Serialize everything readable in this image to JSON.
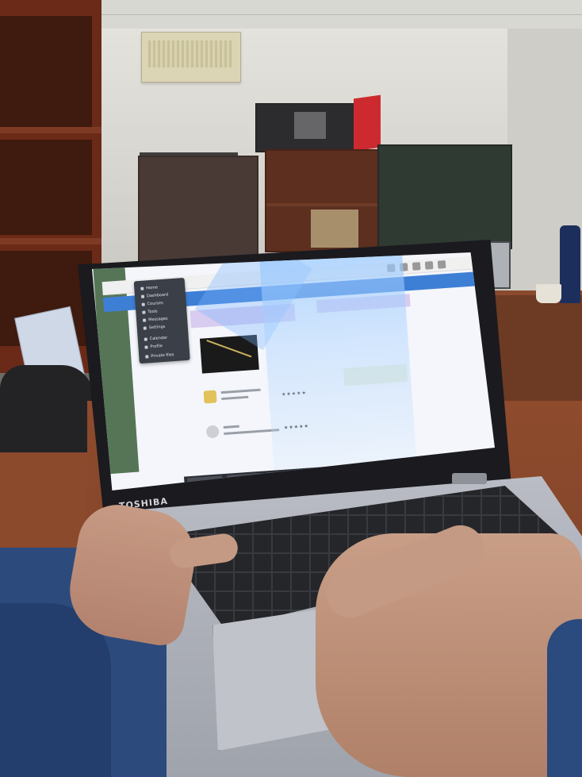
{
  "scene": {
    "description_tags": [
      "laptop-on-desk",
      "office-room",
      "hands-typing"
    ],
    "laptop_brand": "TOSHIBA"
  },
  "screen": {
    "sidebar_items": [
      {
        "label": "Home",
        "icon": "home-icon"
      },
      {
        "label": "Dashboard",
        "icon": "dashboard-icon"
      },
      {
        "label": "Courses",
        "icon": "course-icon"
      },
      {
        "label": "Tools",
        "icon": "tools-icon"
      },
      {
        "label": "Messages",
        "icon": "message-icon"
      },
      {
        "label": "Settings",
        "icon": "gear-icon"
      },
      {
        "label": "Calendar",
        "icon": "calendar-icon"
      },
      {
        "label": "Profile",
        "icon": "profile-icon"
      },
      {
        "label": "Private files",
        "icon": "file-icon"
      }
    ],
    "stars": "★★★★★",
    "taskbar_items": 8
  },
  "colors": {
    "accent_blue": "#3e7fd6",
    "sidebar_dark": "#3a3f48",
    "purple_card": "#d8cdf0",
    "sleeve_blue": "#2c4a7c"
  }
}
